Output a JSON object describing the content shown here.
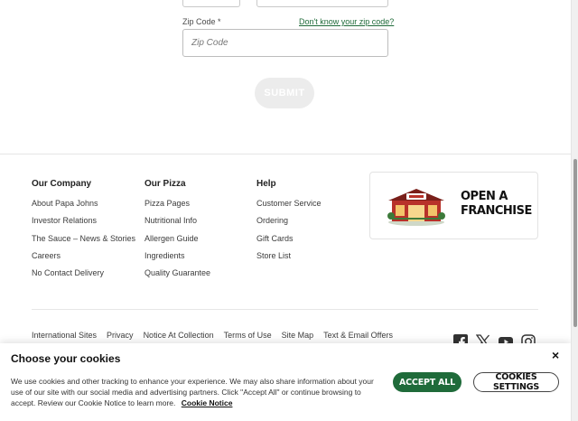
{
  "form": {
    "zip_label": "Zip Code *",
    "zip_help_link": "Don't know your zip code?",
    "zip_placeholder": "Zip Code",
    "submit_label": "SUBMIT"
  },
  "footer": {
    "columns": [
      {
        "heading": "Our Company",
        "links": [
          "About Papa Johns",
          "Investor Relations",
          "The Sauce – News & Stories",
          "Careers",
          "No Contact Delivery"
        ]
      },
      {
        "heading": "Our Pizza",
        "links": [
          "Pizza Pages",
          "Nutritional Info",
          "Allergen Guide",
          "Ingredients",
          "Quality Guarantee"
        ]
      },
      {
        "heading": "Help",
        "links": [
          "Customer Service",
          "Ordering",
          "Gift Cards",
          "Store List"
        ]
      }
    ],
    "franchise": {
      "line1": "OPEN A",
      "line2": "FRANCHISE"
    },
    "legal_links": [
      "International Sites",
      "Privacy",
      "Notice At Collection",
      "Terms of Use",
      "Site Map",
      "Text & Email Offers"
    ],
    "social_icons": [
      "facebook-icon",
      "x-icon",
      "youtube-icon",
      "instagram-icon"
    ]
  },
  "cookie": {
    "title": "Choose your cookies",
    "text": "We use cookies and other tracking to enhance your experience. We may also share information about your use of our site with our social media and advertising partners. Click \"Accept All\" or continue browsing to accept. Review our Cookie Notice to learn more.",
    "notice_link": "Cookie Notice",
    "close_symbol": "×",
    "accept_label": "ACCEPT ALL",
    "settings_label": "COOKIES SETTINGS"
  },
  "colors": {
    "brand_green": "#1f6b3a",
    "submit_disabled": "#ececec"
  }
}
